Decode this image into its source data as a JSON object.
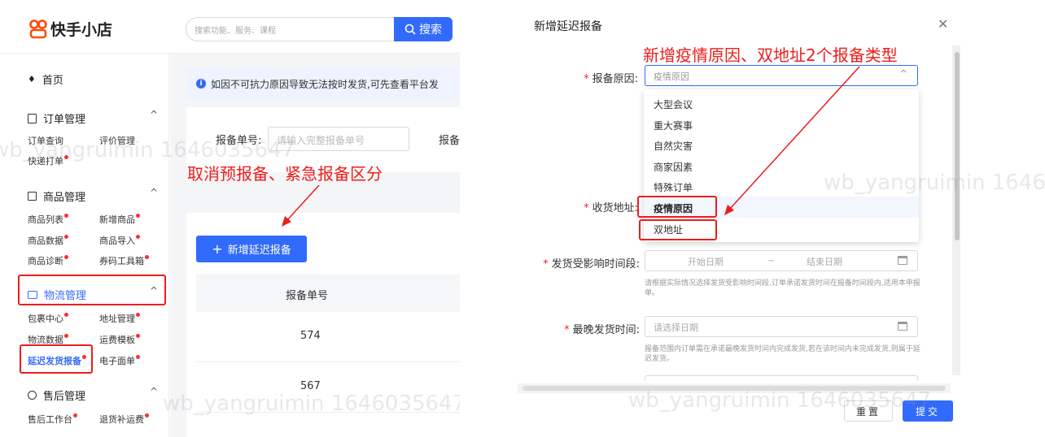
{
  "app": {
    "logo_text": "快手小店"
  },
  "search": {
    "placeholder": "搜索功能、服务、课程",
    "button_label": "搜索"
  },
  "sidebar": {
    "home": "首页",
    "sections": [
      {
        "title": "订单管理",
        "items": [
          "订单查询",
          "评价管理",
          "快递打单"
        ]
      },
      {
        "title": "商品管理",
        "items": [
          "商品列表",
          "新增商品",
          "商品数据",
          "商品导入",
          "商品诊断",
          "券码工具箱"
        ]
      },
      {
        "title": "物流管理",
        "items": [
          "包裹中心",
          "地址管理",
          "物流数据",
          "运费模板",
          "延迟发货报备",
          "电子面单"
        ]
      },
      {
        "title": "售后管理",
        "items": [
          "售后工作台",
          "退货补运费"
        ]
      }
    ]
  },
  "main": {
    "notice": "如因不可抗力原因导致无法按时发货,可先查看平台发",
    "filter_label": "报备单号:",
    "filter_placeholder": "请输入完整报备单号",
    "filter_label_2": "报备",
    "add_button": "新增延迟报备",
    "table_header": "报备单号",
    "rows": [
      "574",
      "567"
    ]
  },
  "modal": {
    "title": "新增延迟报备",
    "reason_label": "报备原因:",
    "reason_value": "疫情原因",
    "options": [
      "大型会议",
      "重大赛事",
      "自然灾害",
      "商家因素",
      "特殊订单",
      "疫情原因",
      "双地址"
    ],
    "address_label": "收货地址:",
    "period_label": "发货受影响时间段:",
    "start_placeholder": "开始日期",
    "end_placeholder": "结束日期",
    "period_hint": "请根据实际情况选择发货受影响时间段,订单承诺发货时间在报备时间段内,适用本申报单。",
    "latest_label": "最晚发货时间:",
    "latest_placeholder": "请选择日期",
    "latest_hint": "报备范围内订单需在承诺最晚发货时间内完成发货,若在该时间内未完成发货,则属于延迟发货。",
    "reset": "重置",
    "submit": "提交"
  },
  "annotations": {
    "left": "取消预报备、紧急报备区分",
    "right": "新增疫情原因、双地址2个报备类型"
  },
  "watermark": "wb_yangruimin 1646035647",
  "colors": {
    "accent": "#326bfb",
    "annotation": "#ee1c1c",
    "required": "#f5222d"
  }
}
